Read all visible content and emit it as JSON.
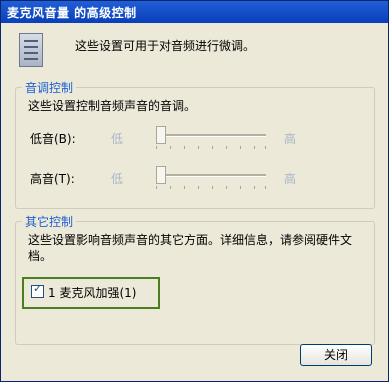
{
  "window": {
    "title": "麦克风音量 的高级控制"
  },
  "intro": {
    "text": "这些设置可用于对音频进行微调。"
  },
  "tone_control": {
    "legend": "音调控制",
    "description": "这些设置控制音频声音的音调。",
    "bass": {
      "label": "低音(B):",
      "low": "低",
      "high": "高",
      "level": 0
    },
    "treble": {
      "label": "高音(T):",
      "low": "低",
      "high": "高",
      "level": 0
    }
  },
  "other_control": {
    "legend": "其它控制",
    "description": "这些设置影响音频声音的其它方面。详细信息，请参阅硬件文档。",
    "mic_boost": {
      "checked": true,
      "label": "1 麦克风加强(1)"
    }
  },
  "buttons": {
    "close": "关闭"
  }
}
